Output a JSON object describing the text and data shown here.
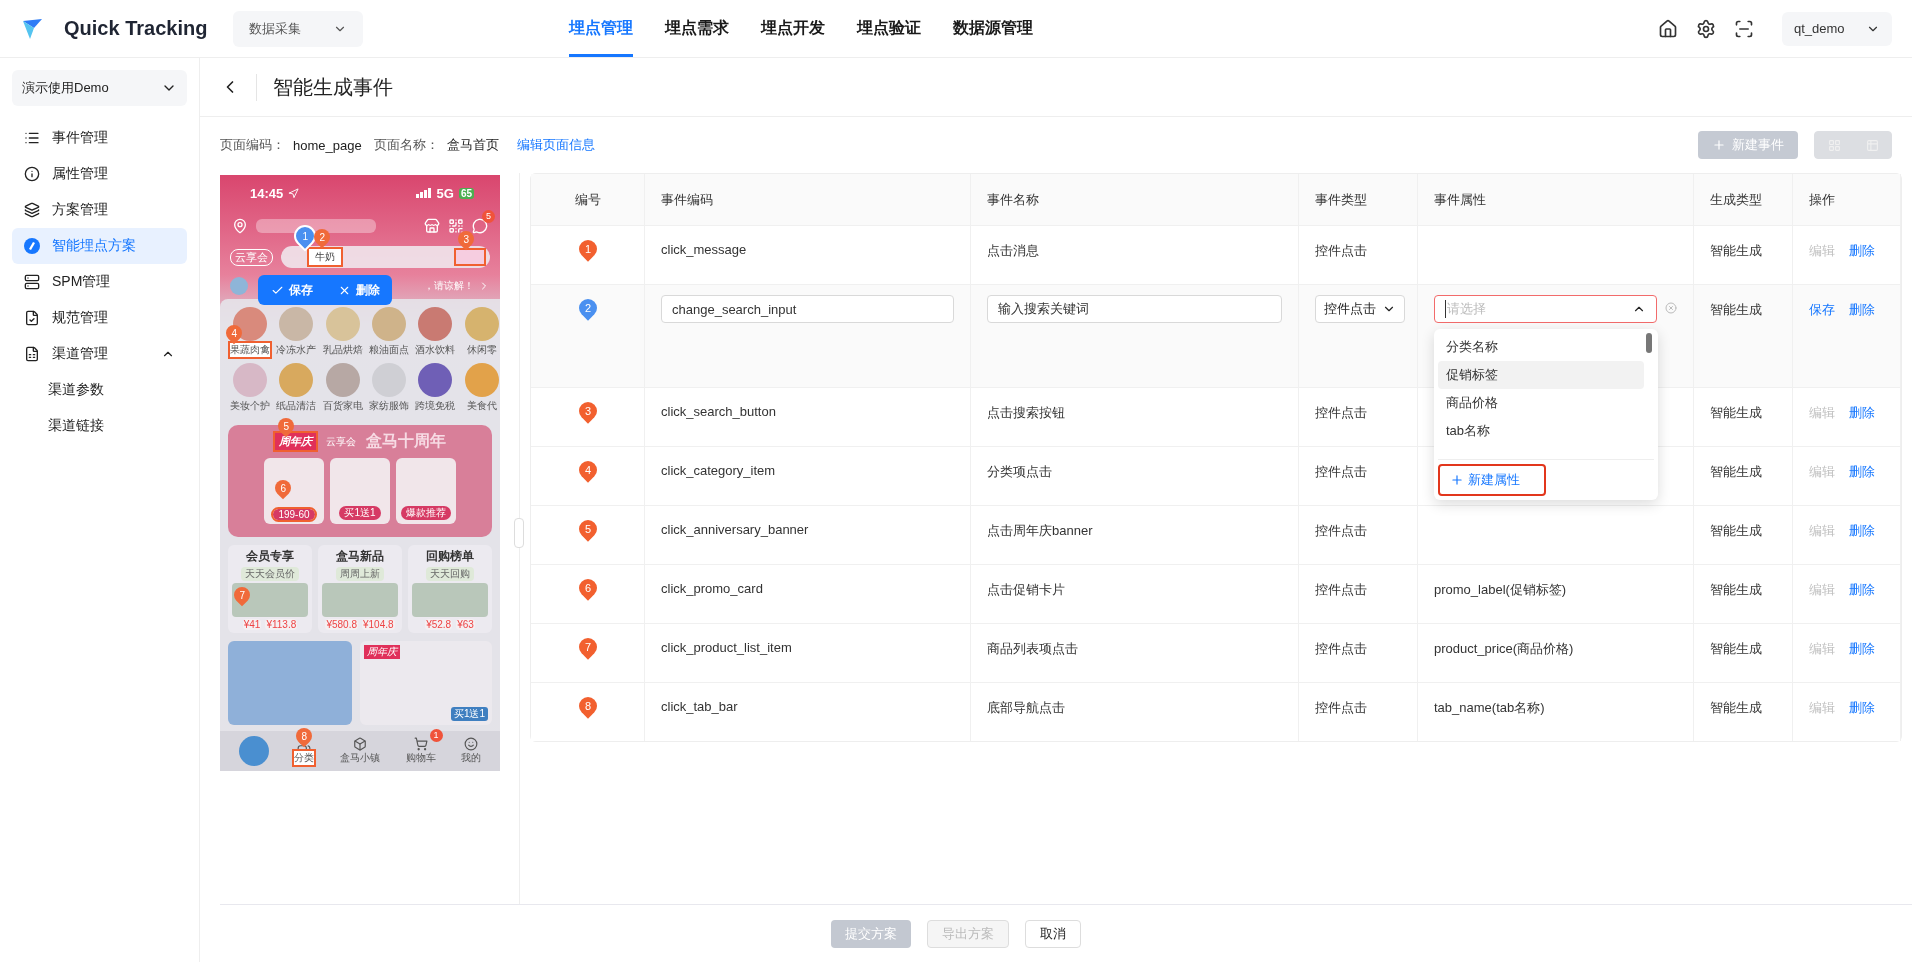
{
  "header": {
    "logo": "Quick Tracking",
    "product_select": "数据采集",
    "nav": [
      {
        "label": "埋点管理",
        "selected": true
      },
      {
        "label": "埋点需求",
        "selected": false
      },
      {
        "label": "埋点开发",
        "selected": false
      },
      {
        "label": "埋点验证",
        "selected": false
      },
      {
        "label": "数据源管理",
        "selected": false
      }
    ],
    "user": "qt_demo"
  },
  "sidebar": {
    "project": "演示使用Demo",
    "items": [
      {
        "label": "事件管理",
        "selected": false
      },
      {
        "label": "属性管理",
        "selected": false
      },
      {
        "label": "方案管理",
        "selected": false
      },
      {
        "label": "智能埋点方案",
        "selected": true
      },
      {
        "label": "SPM管理",
        "selected": false
      },
      {
        "label": "规范管理",
        "selected": false
      },
      {
        "label": "渠道管理",
        "selected": false,
        "expanded": true,
        "children": [
          {
            "label": "渠道参数",
            "selected": false
          },
          {
            "label": "渠道链接",
            "selected": false
          }
        ]
      }
    ]
  },
  "page": {
    "title": "智能生成事件",
    "page_code_label": "页面编码：",
    "page_code": "home_page",
    "page_name_label": "页面名称：",
    "page_name": "盒马首页",
    "edit_link": "编辑页面信息",
    "new_event": {
      "label": "新建事件",
      "disabled": true
    },
    "view_toggle": {
      "disabled": true
    }
  },
  "phone": {
    "time": "14:45",
    "network": "5G",
    "battery": "65",
    "message_badge": "5",
    "brand": "云享会",
    "search_value": "牛奶",
    "notice": "，请谅解！",
    "popup": {
      "save": "保存",
      "delete": "删除"
    },
    "categories": [
      {
        "label": "果蔬肉禽",
        "marked": true
      },
      {
        "label": "冷冻水产",
        "marked": false
      },
      {
        "label": "乳品烘焙",
        "marked": false
      },
      {
        "label": "粮油面点",
        "marked": false
      },
      {
        "label": "酒水饮料",
        "marked": false
      },
      {
        "label": "休闲零",
        "marked": false
      },
      {
        "label": "美妆个护",
        "marked": false
      },
      {
        "label": "纸品清洁",
        "marked": false
      },
      {
        "label": "百货家电",
        "marked": false
      },
      {
        "label": "家纺服饰",
        "marked": false
      },
      {
        "label": "跨境免税",
        "marked": false
      },
      {
        "label": "美食代",
        "marked": false
      }
    ],
    "banner": {
      "tag": "周年庆",
      "brand": "云享会",
      "title": "盒马十周年",
      "cards": [
        {
          "label": "199-60",
          "marked": true
        },
        {
          "label": "买1送1",
          "marked": false
        },
        {
          "label": "爆款推荐",
          "marked": false
        }
      ]
    },
    "sections": [
      {
        "title": "会员专享",
        "tag": "天天会员价",
        "prices": [
          "¥41",
          "¥113.8"
        ]
      },
      {
        "title": "盒马新品",
        "tag": "周周上新",
        "prices": [
          "¥580.8",
          "¥104.8"
        ]
      },
      {
        "title": "回购榜单",
        "tag": "天天回购",
        "prices": [
          "¥52.8",
          "¥63"
        ]
      }
    ],
    "promo_tag": "周年庆",
    "promo_offer": "买1送1",
    "tabs": [
      {
        "label": "分类",
        "marked": true
      },
      {
        "label": "盒马小镇",
        "marked": false
      },
      {
        "label": "购物车",
        "marked": false,
        "badge": "1"
      },
      {
        "label": "我的",
        "marked": false
      }
    ],
    "markers": [
      {
        "label": "1",
        "selected": true
      },
      {
        "label": "2",
        "selected": false
      },
      {
        "label": "3",
        "selected": false
      },
      {
        "label": "4",
        "selected": false
      },
      {
        "label": "5",
        "selected": false
      },
      {
        "label": "6",
        "selected": false
      },
      {
        "label": "7",
        "selected": false
      },
      {
        "label": "8",
        "selected": false
      }
    ]
  },
  "table": {
    "columns": [
      "编号",
      "事件编码",
      "事件名称",
      "事件类型",
      "事件属性",
      "生成类型",
      "操作"
    ],
    "rows": [
      {
        "marker": "1",
        "code": "click_message",
        "name": "点击消息",
        "type": "控件点击",
        "attributes": "",
        "generation": "智能生成",
        "editing": false,
        "actions": [
          {
            "label": "编辑",
            "disabled": true
          },
          {
            "label": "删除",
            "disabled": false
          }
        ]
      },
      {
        "marker": "2",
        "code": "change_search_input",
        "name": "输入搜索关键词",
        "type": "控件点击",
        "attribute_placeholder": "请选择",
        "generation": "智能生成",
        "editing": true,
        "actions": [
          {
            "label": "保存",
            "disabled": false
          },
          {
            "label": "删除",
            "disabled": false
          }
        ]
      },
      {
        "marker": "3",
        "code": "click_search_button",
        "name": "点击搜索按钮",
        "type": "控件点击",
        "attributes": "",
        "generation": "智能生成",
        "editing": false,
        "actions": [
          {
            "label": "编辑",
            "disabled": true
          },
          {
            "label": "删除",
            "disabled": false
          }
        ]
      },
      {
        "marker": "4",
        "code": "click_category_item",
        "name": "分类项点击",
        "type": "控件点击",
        "attributes": "",
        "generation": "智能生成",
        "editing": false,
        "actions": [
          {
            "label": "编辑",
            "disabled": true
          },
          {
            "label": "删除",
            "disabled": false
          }
        ]
      },
      {
        "marker": "5",
        "code": "click_anniversary_banner",
        "name": "点击周年庆banner",
        "type": "控件点击",
        "attributes": "",
        "generation": "智能生成",
        "editing": false,
        "actions": [
          {
            "label": "编辑",
            "disabled": true
          },
          {
            "label": "删除",
            "disabled": false
          }
        ]
      },
      {
        "marker": "6",
        "code": "click_promo_card",
        "name": "点击促销卡片",
        "type": "控件点击",
        "attributes": "promo_label(促销标签)",
        "generation": "智能生成",
        "editing": false,
        "actions": [
          {
            "label": "编辑",
            "disabled": true
          },
          {
            "label": "删除",
            "disabled": false
          }
        ]
      },
      {
        "marker": "7",
        "code": "click_product_list_item",
        "name": "商品列表项点击",
        "type": "控件点击",
        "attributes": "product_price(商品价格)",
        "generation": "智能生成",
        "editing": false,
        "actions": [
          {
            "label": "编辑",
            "disabled": true
          },
          {
            "label": "删除",
            "disabled": false
          }
        ]
      },
      {
        "marker": "8",
        "code": "click_tab_bar",
        "name": "底部导航点击",
        "type": "控件点击",
        "attributes": "tab_name(tab名称)",
        "generation": "智能生成",
        "editing": false,
        "actions": [
          {
            "label": "编辑",
            "disabled": true
          },
          {
            "label": "删除",
            "disabled": false
          }
        ]
      }
    ]
  },
  "attribute_dropdown": {
    "expanded": true,
    "options": [
      {
        "label": "分类名称",
        "selected": false
      },
      {
        "label": "促销标签",
        "selected": true
      },
      {
        "label": "商品价格",
        "selected": false
      },
      {
        "label": "tab名称",
        "selected": false
      }
    ],
    "add_label": "新建属性"
  },
  "footer": {
    "buttons": [
      {
        "label": "提交方案",
        "kind": "primary",
        "disabled": true
      },
      {
        "label": "导出方案",
        "kind": "default",
        "disabled": true
      },
      {
        "label": "取消",
        "kind": "default",
        "disabled": false
      }
    ]
  }
}
